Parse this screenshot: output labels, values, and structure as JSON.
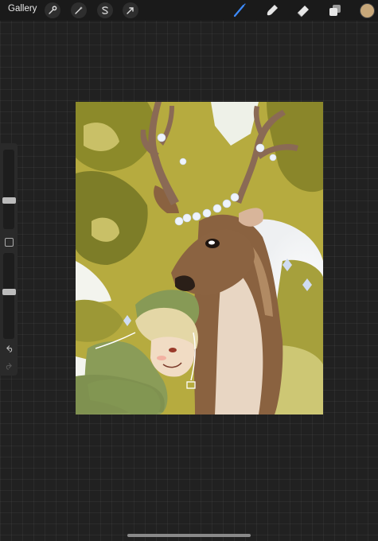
{
  "topbar": {
    "gallery_label": "Gallery",
    "left_tools": [
      {
        "icon": "wrench-icon",
        "name": "actions"
      },
      {
        "icon": "magic-wand-icon",
        "name": "adjustments"
      },
      {
        "icon": "selection-s-icon",
        "name": "selection"
      },
      {
        "icon": "arrow-cursor-icon",
        "name": "transform"
      }
    ],
    "right_tools": [
      {
        "icon": "brush-icon",
        "name": "brush",
        "active": true
      },
      {
        "icon": "smudge-icon",
        "name": "smudge"
      },
      {
        "icon": "eraser-icon",
        "name": "eraser"
      },
      {
        "icon": "layers-icon",
        "name": "layers"
      }
    ],
    "current_color": "#c8a87a"
  },
  "sidebar": {
    "brush_size_level": 0.35,
    "opacity_level": 0.55,
    "undo_icon": "undo-icon",
    "redo_icon": "redo-icon"
  },
  "colors": {
    "active_tool": "#3d8bff",
    "background": "#212121",
    "foliage": "#b5ab40",
    "deer_fur": "#8a6240",
    "hoodie": "#879a56",
    "hair": "#e6d9a8"
  }
}
